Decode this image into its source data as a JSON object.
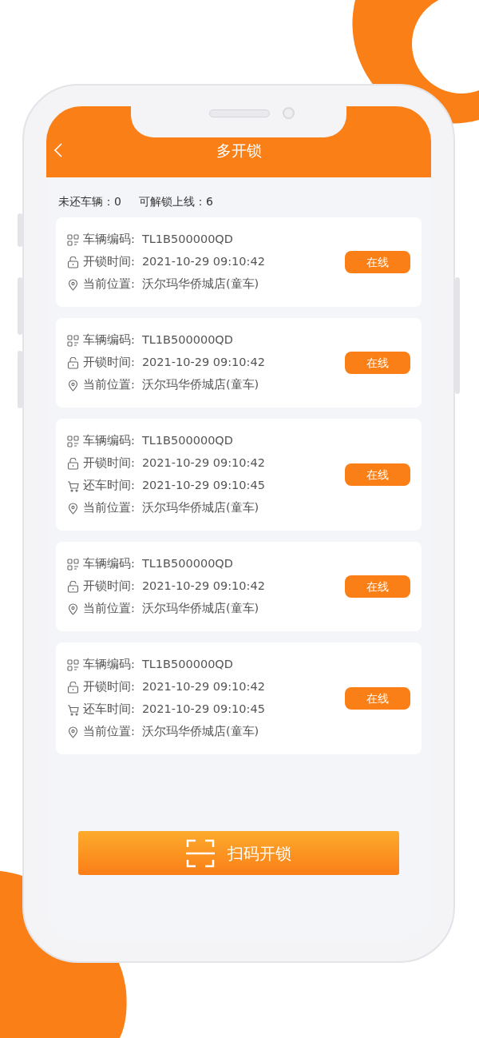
{
  "header": {
    "title": "多开锁"
  },
  "summary": [
    {
      "label": "未还车辆：",
      "value": "0"
    },
    {
      "label": "可解锁上线：",
      "value": "6"
    }
  ],
  "vehicles": [
    {
      "rows": [
        {
          "kind": "code",
          "label": "车辆编码:",
          "value": "TL1B500000QD"
        },
        {
          "kind": "unlock",
          "label": "开锁时间:",
          "value": "2021-10-29 09:10:42"
        },
        {
          "kind": "location",
          "label": "当前位置:",
          "value": "沃尔玛华侨城店(童车)"
        }
      ],
      "status": "在线"
    },
    {
      "rows": [
        {
          "kind": "code",
          "label": "车辆编码:",
          "value": "TL1B500000QD"
        },
        {
          "kind": "unlock",
          "label": "开锁时间:",
          "value": "2021-10-29 09:10:42"
        },
        {
          "kind": "location",
          "label": "当前位置:",
          "value": "沃尔玛华侨城店(童车)"
        }
      ],
      "status": "在线"
    },
    {
      "rows": [
        {
          "kind": "code",
          "label": "车辆编码:",
          "value": "TL1B500000QD"
        },
        {
          "kind": "unlock",
          "label": "开锁时间:",
          "value": "2021-10-29 09:10:42"
        },
        {
          "kind": "return",
          "label": "还车时间:",
          "value": "2021-10-29 09:10:45"
        },
        {
          "kind": "location",
          "label": "当前位置:",
          "value": "沃尔玛华侨城店(童车)"
        }
      ],
      "status": "在线"
    },
    {
      "rows": [
        {
          "kind": "code",
          "label": "车辆编码:",
          "value": "TL1B500000QD"
        },
        {
          "kind": "unlock",
          "label": "开锁时间:",
          "value": "2021-10-29 09:10:42"
        },
        {
          "kind": "location",
          "label": "当前位置:",
          "value": "沃尔玛华侨城店(童车)"
        }
      ],
      "status": "在线"
    },
    {
      "rows": [
        {
          "kind": "code",
          "label": "车辆编码:",
          "value": "TL1B500000QD"
        },
        {
          "kind": "unlock",
          "label": "开锁时间:",
          "value": "2021-10-29 09:10:42"
        },
        {
          "kind": "return",
          "label": "还车时间:",
          "value": "2021-10-29 09:10:45"
        },
        {
          "kind": "location",
          "label": "当前位置:",
          "value": "沃尔玛华侨城店(童车)"
        }
      ],
      "status": "在线"
    }
  ],
  "scan_button": {
    "label": "扫码开锁"
  }
}
